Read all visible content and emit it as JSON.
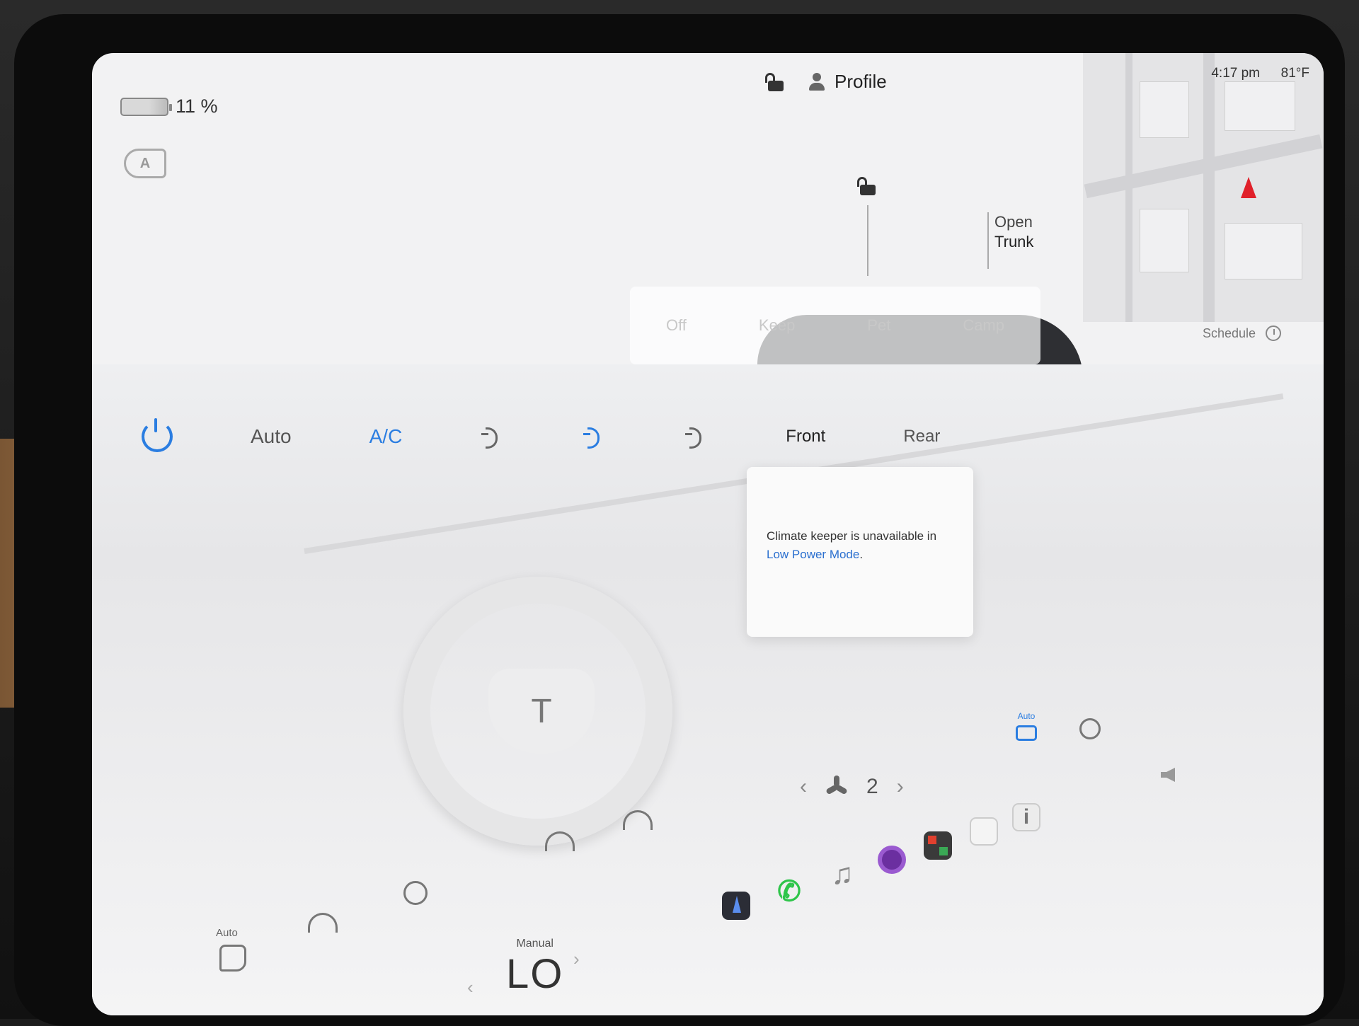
{
  "status": {
    "battery_pct": "11 %",
    "battery_level": 0.11,
    "time": "4:17 pm",
    "temp": "81°F"
  },
  "header": {
    "profile_label": "Profile"
  },
  "car": {
    "trunk_line1": "Open",
    "trunk_line2": "Trunk"
  },
  "climate_keeper": {
    "off": "Off",
    "keep": "Keep",
    "pet": "Pet",
    "camp": "Camp"
  },
  "schedule_label": "Schedule",
  "climate": {
    "auto_label": "Auto",
    "ac_label": "A/C",
    "front_label": "Front",
    "rear_label": "Rear",
    "fan_speed": "2",
    "recirc_label": "Auto"
  },
  "popup": {
    "message": "Climate keeper is unavailable in",
    "link": "Low Power Mode",
    "suffix": "."
  },
  "bottom": {
    "seat_label": "Auto",
    "temp_mode": "Manual",
    "temp_value": "LO"
  },
  "colors": {
    "accent": "#2a7de1",
    "phone": "#2ec54a",
    "nav_arrow": "#e0202a"
  },
  "icons": [
    "battery-icon",
    "headlight-icon",
    "lock-icon",
    "person-icon",
    "nav-arrow-icon",
    "clock-icon",
    "power-icon",
    "vent-icon",
    "fan-icon",
    "recirculate-icon",
    "biohazard-icon",
    "volume-icon",
    "seat-heater-icon",
    "defrost-icon",
    "steering-heat-icon",
    "navigation-app-icon",
    "phone-icon",
    "music-icon",
    "camera-icon",
    "toybox-icon",
    "calendar-icon",
    "info-icon"
  ]
}
